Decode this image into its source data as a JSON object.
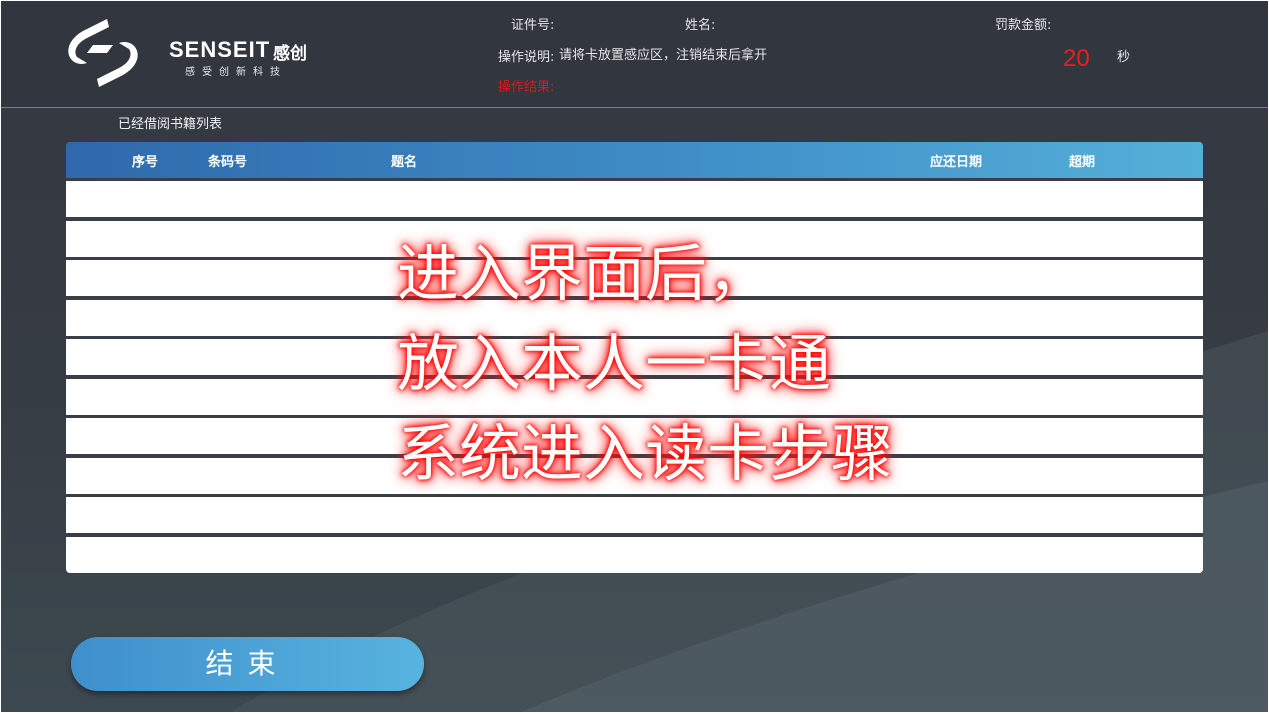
{
  "brand": {
    "name": "SENSEIT",
    "name_cn": "感创",
    "tagline": "感受创新科技"
  },
  "header": {
    "id_label": "证件号:",
    "name_label": "姓名:",
    "fine_label": "罚款金额:",
    "instructions_label": "操作说明:",
    "instructions_text": "请将卡放置感应区，注销结束后拿开",
    "result_label": "操作结果:",
    "countdown_value": "20",
    "countdown_unit": "秒",
    "result_color": "#e01818"
  },
  "list": {
    "title": "已经借阅书籍列表",
    "columns": [
      "序号",
      "条码号",
      "题名",
      "应还日期",
      "超期"
    ],
    "rows": [
      [],
      [],
      [],
      [],
      [],
      [],
      [],
      [],
      [],
      []
    ]
  },
  "overlay": {
    "lines": [
      "进入界面后，",
      "放入本人一卡通",
      "系统进入读卡步骤"
    ],
    "glow_color": "#ff0000"
  },
  "actions": {
    "end_label": "结束"
  }
}
